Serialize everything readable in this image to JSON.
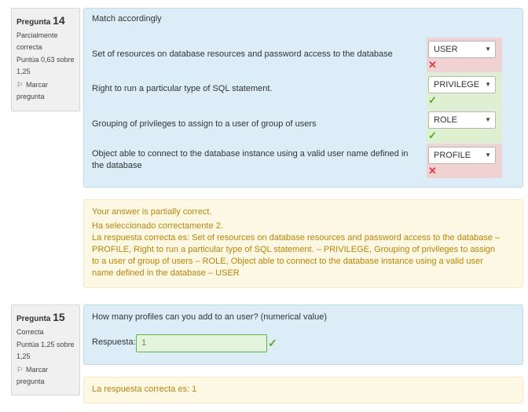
{
  "q14": {
    "info": {
      "label": "Pregunta",
      "number": "14",
      "state": "Parcialmente correcta",
      "grade": "Puntúa 0,63 sobre 1,25",
      "flag_label": "Marcar pregunta"
    },
    "question_text": "Match accordingly",
    "rows": [
      {
        "text": "Set of resources on database resources and password access to the database",
        "selected": "USER",
        "result": "incorrect"
      },
      {
        "text": "Right to run a particular type of SQL statement.",
        "selected": "PRIVILEGE",
        "result": "correct"
      },
      {
        "text": "Grouping of privileges to assign to a user of group of users",
        "selected": "ROLE",
        "result": "correct"
      },
      {
        "text": "Object able to connect to the database instance using a valid user name defined in the database",
        "selected": "PROFILE",
        "result": "incorrect"
      }
    ],
    "feedback": {
      "summary": "Your answer is partially correct.",
      "count": "Ha seleccionado correctamente 2.",
      "right_answer": "La respuesta correcta es: Set of resources on database resources and password access to the database – PROFILE, Right to run a particular type of SQL statement. – PRIVILEGE, Grouping of privileges to assign to a user of group of users – ROLE, Object able to connect to the database instance using a valid user name defined in the database – USER"
    }
  },
  "q15": {
    "info": {
      "label": "Pregunta",
      "number": "15",
      "state": "Correcta",
      "grade": "Puntúa 1,25 sobre 1,25",
      "flag_label": "Marcar pregunta"
    },
    "question_text": "How many profiles can you add to an user? (numerical value)",
    "answer_label": "Respuesta:",
    "answer_value": "1",
    "feedback": {
      "right_answer": "La respuesta correcta es: 1"
    }
  },
  "colors": {
    "formulation_bg": "#dcedf7",
    "feedback_bg": "#fcf8e3",
    "feedback_text": "#b8860b",
    "incorrect_bg": "#f0d2d2",
    "correct_bg": "#def0d0",
    "incorrect_mark": "#e0394a",
    "correct_mark": "#4caf1c"
  },
  "icons": {
    "flag": "flag-icon",
    "dropdown": "caret-down-icon",
    "incorrect": "cross-icon",
    "correct": "check-icon"
  }
}
